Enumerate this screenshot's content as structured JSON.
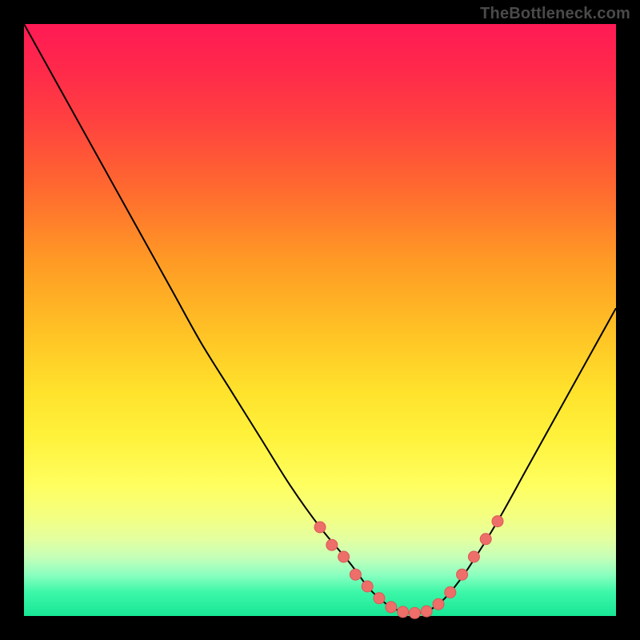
{
  "watermark": "TheBottleneck.com",
  "colors": {
    "curve": "#000000",
    "marker_fill": "#ee6e6a",
    "marker_stroke": "#d85a56"
  },
  "chart_data": {
    "type": "line",
    "title": "",
    "xlabel": "",
    "ylabel": "",
    "xlim": [
      0,
      100
    ],
    "ylim": [
      0,
      100
    ],
    "series": [
      {
        "name": "curve",
        "x": [
          0,
          5,
          10,
          15,
          20,
          25,
          30,
          35,
          40,
          45,
          50,
          55,
          58,
          60,
          62,
          64,
          66,
          68,
          70,
          72,
          75,
          80,
          85,
          90,
          95,
          100
        ],
        "y": [
          100,
          91,
          82,
          73,
          64,
          55,
          46,
          38,
          30,
          22,
          15,
          9,
          5,
          3,
          1.5,
          0.7,
          0.5,
          0.8,
          2,
          4,
          8,
          16,
          25,
          34,
          43,
          52
        ]
      }
    ],
    "markers": [
      {
        "x": 50,
        "y": 15
      },
      {
        "x": 52,
        "y": 12
      },
      {
        "x": 54,
        "y": 10
      },
      {
        "x": 56,
        "y": 7
      },
      {
        "x": 58,
        "y": 5
      },
      {
        "x": 60,
        "y": 3
      },
      {
        "x": 62,
        "y": 1.5
      },
      {
        "x": 64,
        "y": 0.7
      },
      {
        "x": 66,
        "y": 0.5
      },
      {
        "x": 68,
        "y": 0.8
      },
      {
        "x": 70,
        "y": 2
      },
      {
        "x": 72,
        "y": 4
      },
      {
        "x": 74,
        "y": 7
      },
      {
        "x": 76,
        "y": 10
      },
      {
        "x": 78,
        "y": 13
      },
      {
        "x": 80,
        "y": 16
      }
    ]
  }
}
